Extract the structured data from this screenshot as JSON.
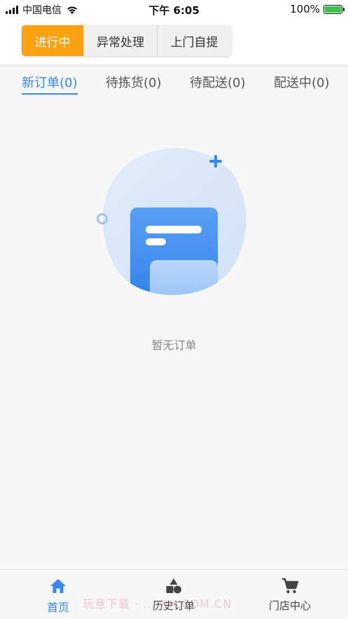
{
  "status_bar": {
    "carrier": "中国电信",
    "time": "下午 6:05",
    "battery": "100%"
  },
  "segment_tabs": [
    {
      "label": "进行中",
      "active": true
    },
    {
      "label": "异常处理",
      "active": false
    },
    {
      "label": "上门自提",
      "active": false
    }
  ],
  "order_tabs": [
    {
      "label": "新订单(0)",
      "active": true
    },
    {
      "label": "待拣货(0)",
      "active": false
    },
    {
      "label": "待配送(0)",
      "active": false
    },
    {
      "label": "配送中(0)",
      "active": false
    }
  ],
  "empty_state": {
    "text": "暂无订单",
    "icon": "empty-document-illustration"
  },
  "bottom_nav": [
    {
      "label": "首页",
      "icon": "home-icon",
      "active": true
    },
    {
      "label": "历史订单",
      "icon": "shapes-icon",
      "active": false
    },
    {
      "label": "门店中心",
      "icon": "cart-icon",
      "active": false
    }
  ],
  "watermark": "玩意下载 · ... XH.COM.CN",
  "colors": {
    "accent_orange": "#fca112",
    "accent_blue": "#3688ef",
    "background": "#f7f7f8"
  }
}
